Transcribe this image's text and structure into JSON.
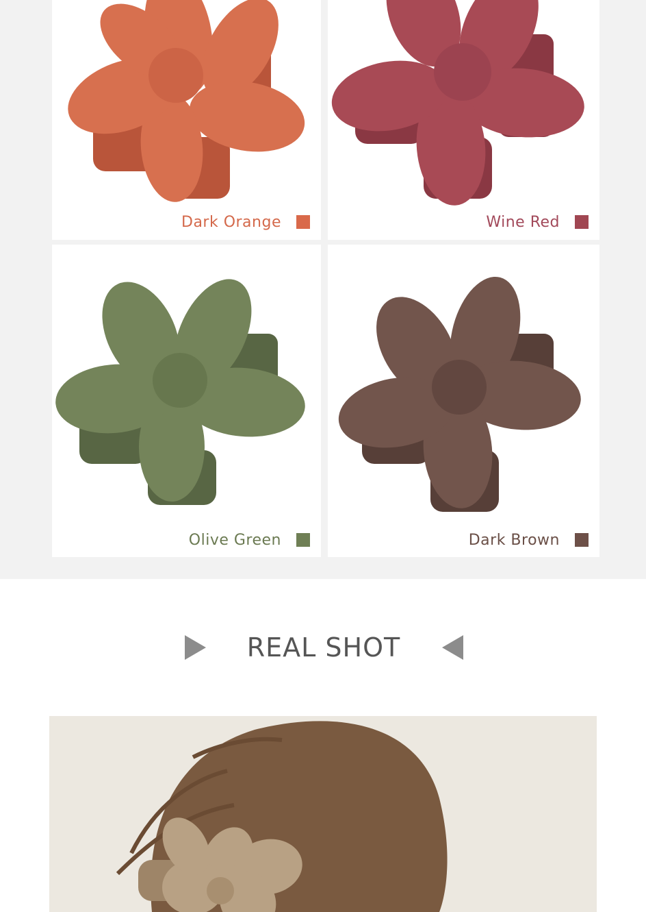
{
  "colors": [
    {
      "name": "Dark Orange",
      "hex": "#d9694a",
      "petal": "#d7704f",
      "shade": "#b9553a",
      "label_color": "#d4694b"
    },
    {
      "name": "Wine Red",
      "hex": "#a04652",
      "petal": "#a84a55",
      "shade": "#8a3843",
      "label_color": "#a2495a"
    },
    {
      "name": "Olive Green",
      "hex": "#6f7f55",
      "petal": "#74845a",
      "shade": "#586644",
      "label_color": "#6b7a52"
    },
    {
      "name": "Dark Brown",
      "hex": "#6d5048",
      "petal": "#72554c",
      "shade": "#573f38",
      "label_color": "#6a4f47"
    }
  ],
  "section": {
    "title": "REAL SHOT",
    "left_arrow": "play-right-icon",
    "right_arrow": "play-left-icon"
  },
  "photo": {
    "description_icon": "hair-clip-photo",
    "clip_color": "#b8a184",
    "hair_color": "#7a5a40",
    "wall_color": "#ece8e0"
  }
}
